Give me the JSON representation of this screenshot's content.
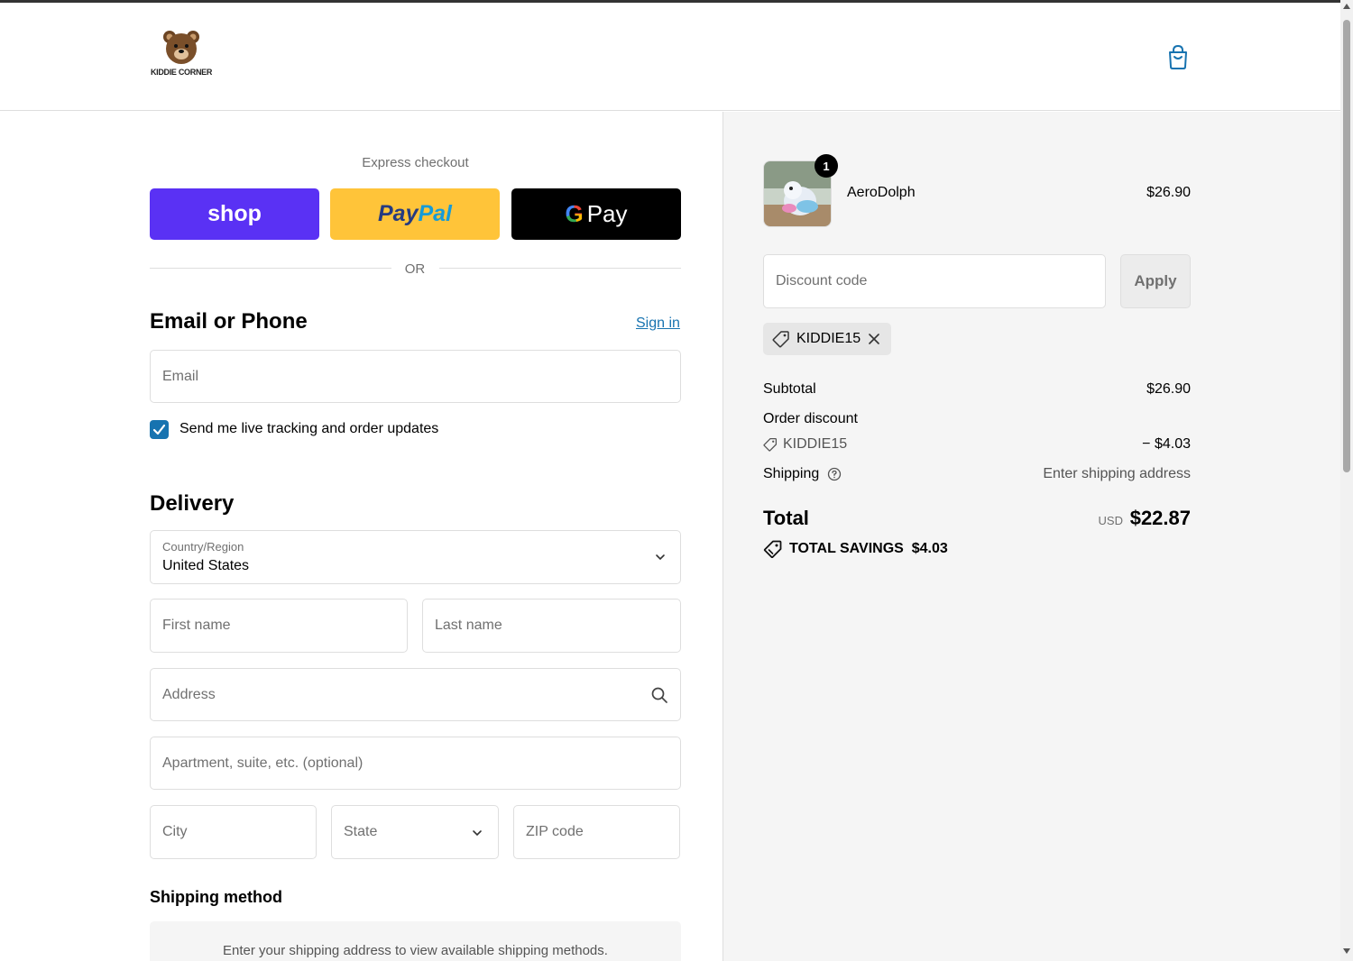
{
  "header": {
    "store_name": "KIDDIE CORNER",
    "cart_icon": "shopping-bag-icon"
  },
  "express": {
    "label": "Express checkout",
    "shop_label": "shop",
    "paypal_label_1": "Pay",
    "paypal_label_2": "Pal",
    "gpay_g": "G",
    "gpay_label": "Pay",
    "or_label": "OR"
  },
  "contact": {
    "title": "Email or Phone",
    "signin_label": "Sign in",
    "email_placeholder": "Email",
    "checkbox_checked": true,
    "checkbox_label": "Send me live tracking and order updates"
  },
  "delivery": {
    "title": "Delivery",
    "country_label": "Country/Region",
    "country_value": "United States",
    "first_name_placeholder": "First name",
    "last_name_placeholder": "Last name",
    "address_placeholder": "Address",
    "apartment_placeholder": "Apartment, suite, etc. (optional)",
    "city_placeholder": "City",
    "state_placeholder": "State",
    "zip_placeholder": "ZIP code"
  },
  "shipping": {
    "title": "Shipping method",
    "info": "Enter your shipping address to view available shipping methods."
  },
  "summary": {
    "item_quantity": "1",
    "item_name": "AeroDolph",
    "item_price": "$26.90",
    "discount_placeholder": "Discount code",
    "apply_label": "Apply",
    "applied_code": "KIDDIE15",
    "subtotal_label": "Subtotal",
    "subtotal_value": "$26.90",
    "order_discount_label": "Order discount",
    "discount_code": "KIDDIE15",
    "discount_value": "− $4.03",
    "shipping_label": "Shipping",
    "shipping_value": "Enter shipping address",
    "total_label": "Total",
    "total_currency": "USD",
    "total_value": "$22.87",
    "savings_label": "TOTAL SAVINGS",
    "savings_value": "$4.03"
  },
  "colors": {
    "accent": "#1773b0",
    "shop_pay": "#5a31f4",
    "paypal": "#ffc439",
    "gpay": "#000000"
  }
}
